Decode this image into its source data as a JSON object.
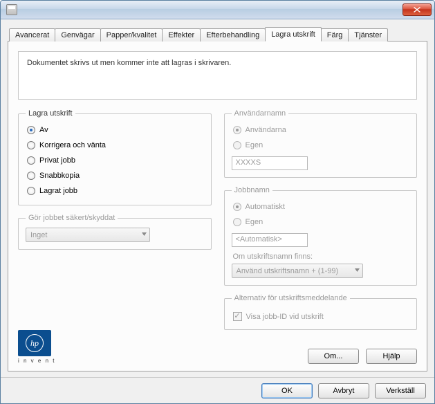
{
  "tabs": {
    "avancerat": "Avancerat",
    "genvagar": "Genvägar",
    "papper": "Papper/kvalitet",
    "effekter": "Effekter",
    "efterbehandling": "Efterbehandling",
    "lagra": "Lagra utskrift",
    "farg": "Färg",
    "tjanster": "Tjänster"
  },
  "info_text": "Dokumentet skrivs ut men kommer inte att lagras i skrivaren.",
  "lagra": {
    "legend": "Lagra utskrift",
    "av": "Av",
    "korrigera": "Korrigera och vänta",
    "privat": "Privat jobb",
    "snabbkopia": "Snabbkopia",
    "lagrat": "Lagrat jobb"
  },
  "sakert": {
    "legend": "Gör jobbet säkert/skyddat",
    "value": "Inget"
  },
  "anvandarnamn": {
    "legend": "Användarnamn",
    "anvandarna": "Användarna",
    "egen": "Egen",
    "value": "XXXXS"
  },
  "jobbnamn": {
    "legend": "Jobbnamn",
    "automatiskt": "Automatiskt",
    "egen": "Egen",
    "value": "<Automatisk>",
    "om_finns_label": "Om utskriftsnamn finns:",
    "om_finns_value": "Använd utskriftsnamn + (1-99)"
  },
  "alternativ": {
    "legend": "Alternativ för utskriftsmeddelande",
    "visa_id": "Visa jobb-ID vid utskrift"
  },
  "logo_invent": "i n v e n t",
  "buttons": {
    "om": "Om...",
    "hjalp": "Hjälp",
    "ok": "OK",
    "avbryt": "Avbryt",
    "verkstall": "Verkställ"
  }
}
